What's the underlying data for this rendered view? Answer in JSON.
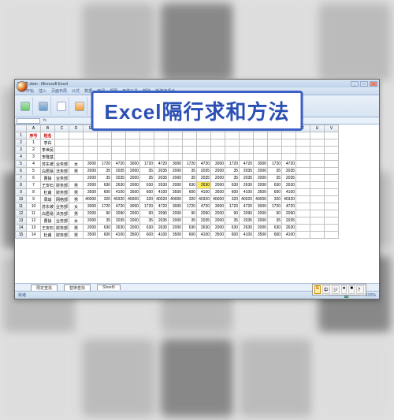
{
  "overlay_title": "Excel隔行求和方法",
  "window": {
    "title": "工资表.xlsm - Microsoft Excel",
    "min": "_",
    "max": "□",
    "close": "×"
  },
  "ribbon": {
    "tabs": [
      "开始",
      "插入",
      "页面布局",
      "公式",
      "数据",
      "审阅",
      "视图",
      "开发工具",
      "帮助",
      "新建选项卡"
    ]
  },
  "formula_bar": {
    "name_box": "",
    "fx": "fx"
  },
  "headers": {
    "row": [
      "A",
      "B",
      "C",
      "D",
      "E",
      "F",
      "G",
      "H",
      "I",
      "J",
      "K",
      "L",
      "M",
      "N",
      "O",
      "P",
      "Q",
      "R",
      "S",
      "T",
      "U",
      "V"
    ],
    "data": [
      "序号",
      "姓名",
      "",
      "",
      "",
      "",
      "",
      "",
      "",
      "",
      "",
      "",
      "",
      "",
      "",
      "",
      "",
      "",
      "",
      "",
      "",
      ""
    ]
  },
  "rows": [
    {
      "n": "1",
      "c": [
        "1",
        "李白",
        "",
        "",
        "",
        "",
        "",
        "",
        "",
        "",
        "",
        "",
        "",
        "",
        "",
        "",
        "",
        "",
        "",
        "",
        "",
        ""
      ]
    },
    {
      "n": "2",
      "c": [
        "2",
        "李世民",
        "",
        "",
        "",
        "",
        "",
        "",
        "",
        "",
        "",
        "",
        "",
        "",
        "",
        "",
        "",
        "",
        "",
        "",
        "",
        ""
      ]
    },
    {
      "n": "3",
      "c": [
        "3",
        "李隆基",
        "",
        "",
        "",
        "",
        "",
        "",
        "",
        "",
        "",
        "",
        "",
        "",
        "",
        "",
        "",
        "",
        "",
        "",
        "",
        ""
      ]
    },
    {
      "n": "4",
      "c": [
        "4",
        "苏东坡",
        "业务部",
        "女",
        "3000",
        "1720",
        "4720",
        "3000",
        "1720",
        "4720",
        "3000",
        "1720",
        "4720",
        "3000",
        "1720",
        "4720",
        "3000",
        "1720",
        "4720"
      ]
    },
    {
      "n": "5",
      "c": [
        "5",
        "白居易",
        "法务部",
        "男",
        "2000",
        "35",
        "2035",
        "2000",
        "35",
        "2035",
        "2000",
        "35",
        "2035",
        "2000",
        "35",
        "2035",
        "2000",
        "35",
        "2035"
      ]
    },
    {
      "n": "6",
      "c": [
        "6",
        "曹操",
        "业务部",
        "",
        "2000",
        "35",
        "2035",
        "2000",
        "35",
        "2035",
        "2000",
        "35",
        "2035",
        "2000",
        "35",
        "2035",
        "2000",
        "35",
        "2035"
      ]
    },
    {
      "n": "7",
      "c": [
        "7",
        "王安石",
        "财务部",
        "男",
        "2000",
        "630",
        "2630",
        "2000",
        "630",
        "2630",
        "2000",
        "630",
        "2630",
        "2000",
        "630",
        "2630",
        "2000",
        "630",
        "2630"
      ],
      "hi": 12
    },
    {
      "n": "8",
      "c": [
        "8",
        "杜甫",
        "财务部",
        "男",
        "3500",
        "600",
        "4100",
        "3500",
        "600",
        "4100",
        "3500",
        "600",
        "4100",
        "3500",
        "600",
        "4100",
        "3500",
        "600",
        "4100"
      ]
    },
    {
      "n": "9",
      "c": [
        "9",
        "周瑜",
        "网络部",
        "男",
        "40000",
        "320",
        "40320",
        "40000",
        "320",
        "40320",
        "40000",
        "320",
        "40320",
        "40000",
        "320",
        "40320",
        "40000",
        "320",
        "40320"
      ]
    },
    {
      "n": "10",
      "c": [
        "10",
        "苏东坡",
        "业务部",
        "女",
        "3000",
        "1720",
        "4720",
        "3000",
        "1720",
        "4720",
        "3000",
        "1720",
        "4720",
        "3000",
        "1720",
        "4720",
        "3000",
        "1720",
        "4720"
      ]
    },
    {
      "n": "11",
      "c": [
        "11",
        "白居易",
        "法务部",
        "男",
        "2000",
        "90",
        "2090",
        "2000",
        "90",
        "2090",
        "2000",
        "90",
        "2090",
        "2000",
        "90",
        "2090",
        "2000",
        "90",
        "2090"
      ]
    },
    {
      "n": "12",
      "c": [
        "12",
        "曹操",
        "业务部",
        "女",
        "2000",
        "35",
        "2035",
        "2000",
        "35",
        "2035",
        "2000",
        "35",
        "2035",
        "2000",
        "35",
        "2035",
        "2000",
        "35",
        "2035"
      ]
    },
    {
      "n": "13",
      "c": [
        "13",
        "王安石",
        "财务部",
        "男",
        "2000",
        "630",
        "2630",
        "2000",
        "630",
        "2630",
        "2000",
        "630",
        "2630",
        "2000",
        "630",
        "2630",
        "2000",
        "630",
        "2630"
      ]
    },
    {
      "n": "14",
      "c": [
        "14",
        "杜甫",
        "财务部",
        "男",
        "3500",
        "600",
        "4100",
        "3500",
        "600",
        "4100",
        "3500",
        "600",
        "4100",
        "3500",
        "600",
        "4100",
        "3500",
        "600",
        "4100"
      ]
    }
  ],
  "sheet_tabs": [
    "限定查找",
    "替换查找",
    "Sheet5"
  ],
  "status": {
    "left": "就绪  ",
    "right_text": "100%"
  },
  "ime": [
    "S",
    "中",
    "ジ",
    "●",
    "■",
    "？"
  ]
}
